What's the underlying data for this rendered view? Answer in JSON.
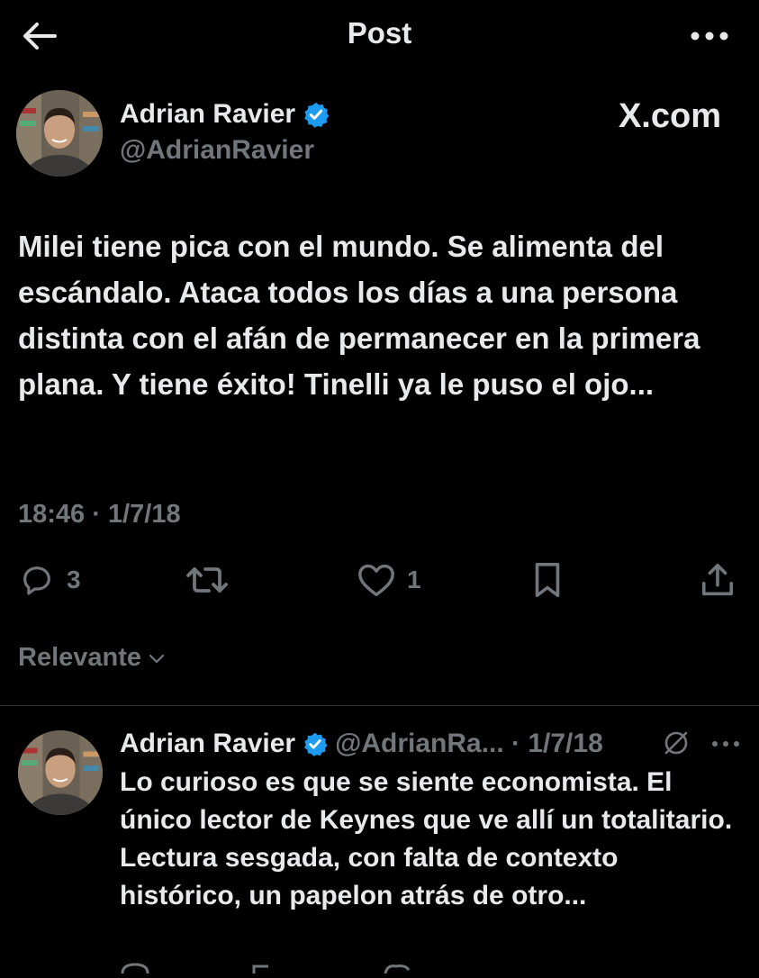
{
  "header": {
    "title": "Post",
    "back_icon": "arrow-left-icon",
    "more_icon": "ellipsis-icon"
  },
  "post": {
    "author_name": "Adrian Ravier",
    "author_handle": "@AdrianRavier",
    "verified_color": "#1d9bf0",
    "watermark": "X.com",
    "text": "Milei tiene pica con el mundo. Se alimenta del escándalo. Ataca todos los días a una persona distinta con el afán de permanecer en la primera plana. Y tiene éxito! Tinelli ya le puso el ojo...",
    "timestamp": "18:46 · 1/7/18",
    "actions": {
      "replies": "3",
      "retweets": "",
      "likes": "1",
      "bookmarks": "",
      "share": ""
    }
  },
  "sort": {
    "label": "Relevante"
  },
  "reply": {
    "author_name": "Adrian Ravier",
    "meta": "@AdrianRa... · 1/7/18",
    "text": "Lo curioso es que se siente economista. El único lector de Keynes que ve allí un totalitario. Lectura sesgada, con falta de contexto histórico, un papelon atrás de otro..."
  },
  "colors": {
    "background": "#000000",
    "text_primary": "#e7e9ea",
    "text_secondary": "#71767b",
    "divider": "#2f3336",
    "accent": "#1d9bf0"
  }
}
